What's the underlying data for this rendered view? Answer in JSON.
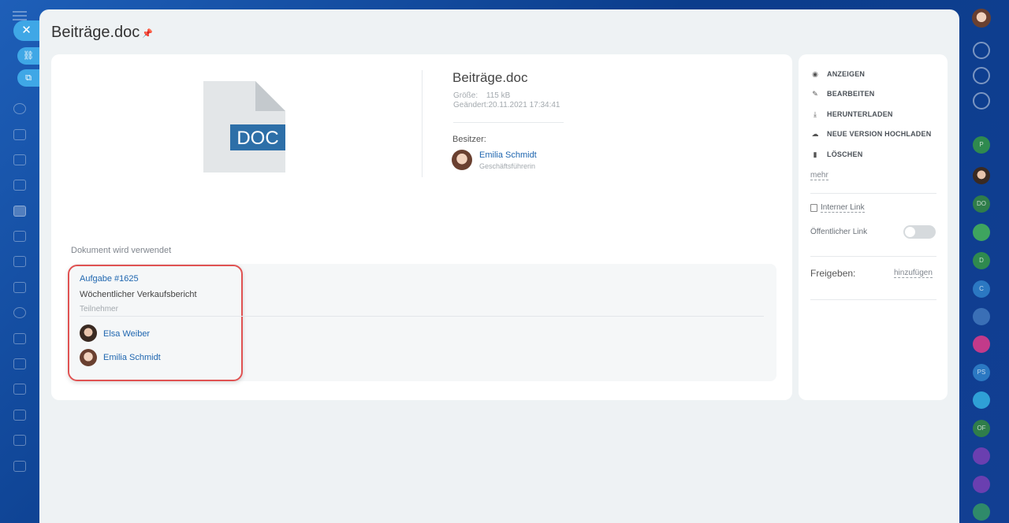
{
  "window": {
    "close_icon": "close-icon"
  },
  "document": {
    "title": "Beiträge.doc",
    "icon_label": "DOC",
    "file_name": "Beiträge.doc",
    "size_label": "Größe:",
    "size_value": "115 kB",
    "changed_label": "Geändert:",
    "changed_value": "20.11.2021 17:34:41",
    "owner_label": "Besitzer:",
    "owner_name": "Emilia Schmidt",
    "owner_role": "Geschäftsführerin"
  },
  "usage": {
    "label": "Dokument wird verwendet",
    "task_link": "Aufgabe #1625",
    "task_name": "Wöchentlicher Verkaufsbericht",
    "participants_label": "Teilnehmer",
    "participants": [
      "Elsa Weiber",
      "Emilia Schmidt"
    ]
  },
  "actions": {
    "items": [
      {
        "label": "ANZEIGEN",
        "icon": "eye-icon"
      },
      {
        "label": "BEARBEITEN",
        "icon": "pencil-icon"
      },
      {
        "label": "HERUNTERLADEN",
        "icon": "download-icon"
      },
      {
        "label": "NEUE VERSION HOCHLADEN",
        "icon": "upload-cloud-icon"
      },
      {
        "label": "LÖSCHEN",
        "icon": "trash-icon"
      }
    ],
    "more": "mehr",
    "internal_link": "Interner Link",
    "public_link": "Öffentlicher Link",
    "public_link_enabled": false,
    "share_label": "Freigeben:",
    "share_add": "hinzufügen"
  },
  "right_rail": {
    "items": [
      "P",
      "DO",
      "D",
      "C",
      "PS",
      "OF"
    ]
  },
  "colors": {
    "accent": "#2067b0",
    "doc_badge": "#2d6fa8",
    "highlight": "#e05252",
    "rail_blue": "#3fa7e6"
  }
}
